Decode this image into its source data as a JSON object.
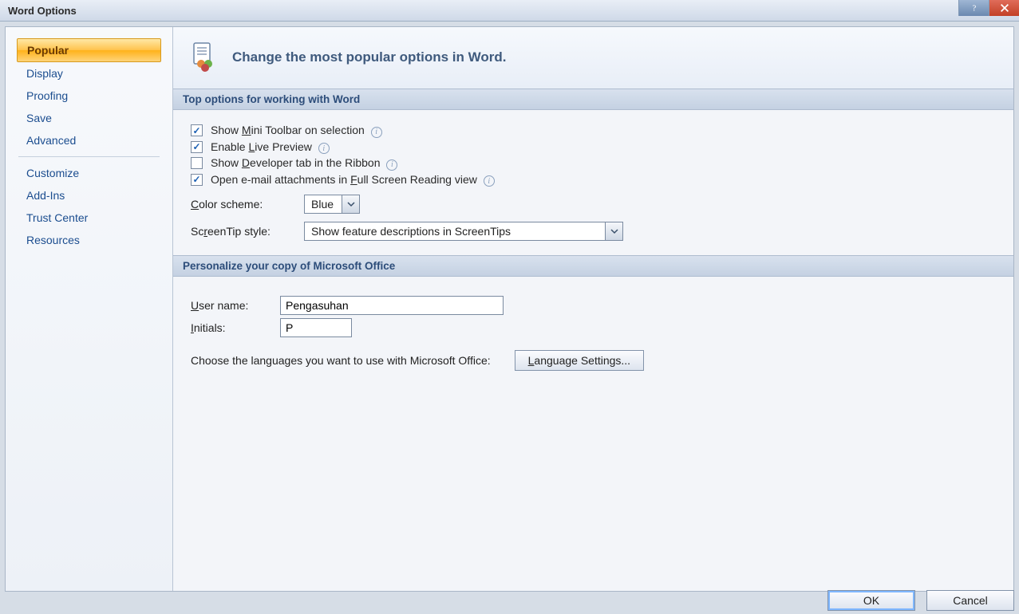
{
  "window": {
    "title": "Word Options"
  },
  "sidebar": {
    "items": [
      {
        "label": "Popular",
        "selected": true
      },
      {
        "label": "Display",
        "selected": false
      },
      {
        "label": "Proofing",
        "selected": false
      },
      {
        "label": "Save",
        "selected": false
      },
      {
        "label": "Advanced",
        "selected": false
      },
      {
        "label": "Customize",
        "selected": false
      },
      {
        "label": "Add-Ins",
        "selected": false
      },
      {
        "label": "Trust Center",
        "selected": false
      },
      {
        "label": "Resources",
        "selected": false
      }
    ]
  },
  "heading": "Change the most popular options in Word.",
  "sections": {
    "top": {
      "title": "Top options for working with Word",
      "checkboxes": [
        {
          "label_pre": "Show ",
          "accel": "M",
          "label_post": "ini Toolbar on selection",
          "checked": true,
          "info": true
        },
        {
          "label_pre": "Enable ",
          "accel": "L",
          "label_post": "ive Preview",
          "checked": true,
          "info": true
        },
        {
          "label_pre": "Show ",
          "accel": "D",
          "label_post": "eveloper tab in the Ribbon",
          "checked": false,
          "info": true
        },
        {
          "label_pre": "Open e-mail attachments in ",
          "accel": "F",
          "label_post": "ull Screen Reading view",
          "checked": true,
          "info": true
        }
      ],
      "color_scheme": {
        "label_accel": "C",
        "label_rest": "olor scheme:",
        "value": "Blue"
      },
      "screentip": {
        "label_pre": "Sc",
        "label_accel": "r",
        "label_post": "eenTip style:",
        "value": "Show feature descriptions in ScreenTips"
      }
    },
    "personalize": {
      "title": "Personalize your copy of Microsoft Office",
      "username": {
        "label_accel": "U",
        "label_rest": "ser name:",
        "value": "Pengasuhan"
      },
      "initials": {
        "label_accel": "I",
        "label_rest": "nitials:",
        "value": "P"
      },
      "lang_prompt": "Choose the languages you want to use with Microsoft Office:",
      "lang_btn": {
        "accel": "L",
        "rest": "anguage Settings..."
      }
    }
  },
  "footer": {
    "ok": "OK",
    "cancel": "Cancel"
  }
}
